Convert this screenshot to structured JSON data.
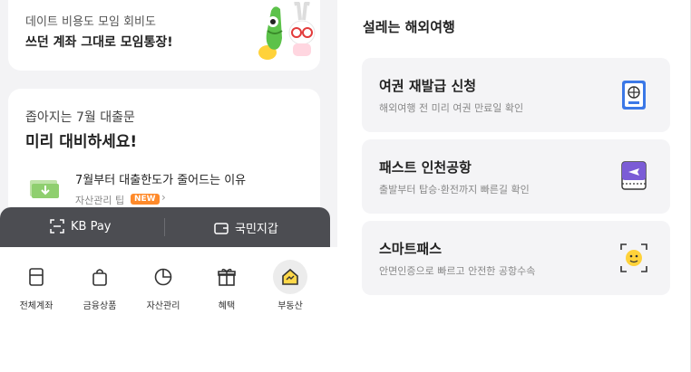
{
  "left": {
    "promo_card": {
      "line1": "데이트 비용도 모임 회비도",
      "line2": "쓰던 계좌 그대로 모임통장!"
    },
    "loan_card": {
      "line1": "좁아지는 7월 대출문",
      "line2": "미리 대비하세요!",
      "article_title": "7월부터 대출한도가 줄어드는 이유",
      "article_sub": "자산관리 팁",
      "badge": "NEW"
    },
    "paybar": {
      "kbpay_label": "KB Pay",
      "kukmin_label": "국민지갑"
    },
    "tabs": [
      {
        "label": "전체계좌",
        "icon": "account-book-icon"
      },
      {
        "label": "금융상품",
        "icon": "shopping-bag-icon"
      },
      {
        "label": "자산관리",
        "icon": "pie-chart-icon"
      },
      {
        "label": "혜택",
        "icon": "gift-icon"
      },
      {
        "label": "부동산",
        "icon": "house-icon"
      }
    ]
  },
  "right": {
    "title": "설레는 해외여행",
    "services": [
      {
        "title": "여권 재발급 신청",
        "desc": "해외여행 전 미리 여권 만료일 확인",
        "icon": "passport-icon"
      },
      {
        "title": "패스트 인천공항",
        "desc": "출발부터 탑승·환전까지 빠른길 확인",
        "icon": "boarding-pass-icon"
      },
      {
        "title": "스마트패스",
        "desc": "안면인증으로 빠르고 안전한 공항수속",
        "icon": "face-id-icon"
      }
    ]
  },
  "colors": {
    "paybar": "#4c4d52",
    "new_badge": "#ff8a2a",
    "card_bg": "#f4f4f6"
  }
}
